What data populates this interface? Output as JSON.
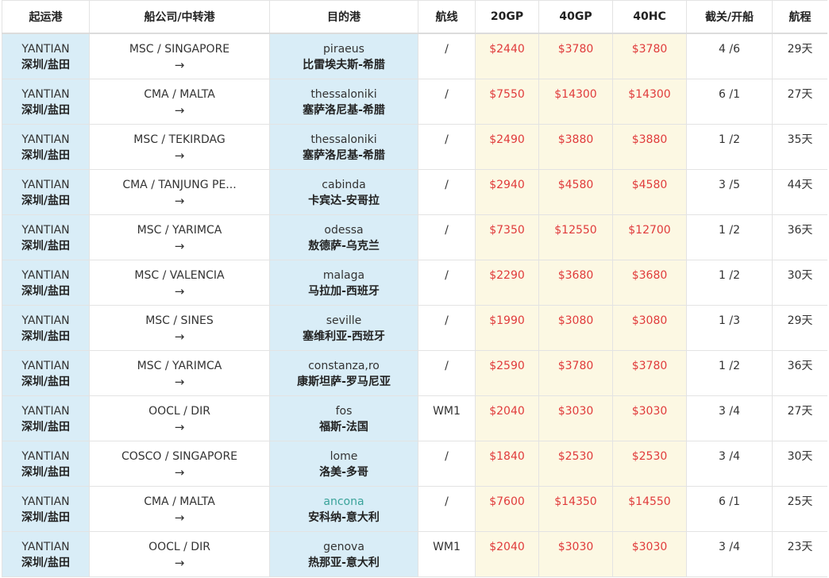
{
  "table": {
    "headers": [
      "起运港",
      "船公司/中转港",
      "目的港",
      "航线",
      "20GP",
      "40GP",
      "40HC",
      "截关/开船",
      "航程"
    ],
    "rows": [
      {
        "origin_en": "YANTIAN",
        "origin_cn": "深圳/盐田",
        "carrier": "MSC / SINGAPORE",
        "arrow": "→",
        "dest_en": "piraeus",
        "dest_cn": "比雷埃夫斯-希腊",
        "route": "/",
        "gp20": "$2440",
        "gp40": "$3780",
        "hc40": "$3780",
        "cutoff": "4 /6",
        "transit": "29天"
      },
      {
        "origin_en": "YANTIAN",
        "origin_cn": "深圳/盐田",
        "carrier": "CMA / MALTA",
        "arrow": "→",
        "dest_en": "thessaloniki",
        "dest_cn": "塞萨洛尼基-希腊",
        "route": "/",
        "gp20": "$7550",
        "gp40": "$14300",
        "hc40": "$14300",
        "cutoff": "6 /1",
        "transit": "27天"
      },
      {
        "origin_en": "YANTIAN",
        "origin_cn": "深圳/盐田",
        "carrier": "MSC / TEKIRDAG",
        "arrow": "→",
        "dest_en": "thessaloniki",
        "dest_cn": "塞萨洛尼基-希腊",
        "route": "/",
        "gp20": "$2490",
        "gp40": "$3880",
        "hc40": "$3880",
        "cutoff": "1 /2",
        "transit": "35天"
      },
      {
        "origin_en": "YANTIAN",
        "origin_cn": "深圳/盐田",
        "carrier": "CMA / TANJUNG PE...",
        "arrow": "→",
        "dest_en": "cabinda",
        "dest_cn": "卡宾达-安哥拉",
        "route": "/",
        "gp20": "$2940",
        "gp40": "$4580",
        "hc40": "$4580",
        "cutoff": "3 /5",
        "transit": "44天"
      },
      {
        "origin_en": "YANTIAN",
        "origin_cn": "深圳/盐田",
        "carrier": "MSC / YARIMCA",
        "arrow": "→",
        "dest_en": "odessa",
        "dest_cn": "敖德萨-乌克兰",
        "route": "/",
        "gp20": "$7350",
        "gp40": "$12550",
        "hc40": "$12700",
        "cutoff": "1 /2",
        "transit": "36天"
      },
      {
        "origin_en": "YANTIAN",
        "origin_cn": "深圳/盐田",
        "carrier": "MSC / VALENCIA",
        "arrow": "→",
        "dest_en": "malaga",
        "dest_cn": "马拉加-西班牙",
        "route": "/",
        "gp20": "$2290",
        "gp40": "$3680",
        "hc40": "$3680",
        "cutoff": "1 /2",
        "transit": "30天"
      },
      {
        "origin_en": "YANTIAN",
        "origin_cn": "深圳/盐田",
        "carrier": "MSC / SINES",
        "arrow": "→",
        "dest_en": "seville",
        "dest_cn": "塞维利亚-西班牙",
        "route": "/",
        "gp20": "$1990",
        "gp40": "$3080",
        "hc40": "$3080",
        "cutoff": "1 /3",
        "transit": "29天"
      },
      {
        "origin_en": "YANTIAN",
        "origin_cn": "深圳/盐田",
        "carrier": "MSC / YARIMCA",
        "arrow": "→",
        "dest_en": "constanza,ro",
        "dest_cn": "康斯坦萨-罗马尼亚",
        "route": "/",
        "gp20": "$2590",
        "gp40": "$3780",
        "hc40": "$3780",
        "cutoff": "1 /2",
        "transit": "36天"
      },
      {
        "origin_en": "YANTIAN",
        "origin_cn": "深圳/盐田",
        "carrier": "OOCL / DIR",
        "arrow": "→",
        "dest_en": "fos",
        "dest_cn": "福斯-法国",
        "route": "WM1",
        "gp20": "$2040",
        "gp40": "$3030",
        "hc40": "$3030",
        "cutoff": "3 /4",
        "transit": "27天"
      },
      {
        "origin_en": "YANTIAN",
        "origin_cn": "深圳/盐田",
        "carrier": "COSCO / SINGAPORE",
        "arrow": "→",
        "dest_en": "lome",
        "dest_cn": "洛美-多哥",
        "route": "/",
        "gp20": "$1840",
        "gp40": "$2530",
        "hc40": "$2530",
        "cutoff": "3 /4",
        "transit": "30天"
      },
      {
        "origin_en": "YANTIAN",
        "origin_cn": "深圳/盐田",
        "carrier": "CMA / MALTA",
        "arrow": "→",
        "dest_en": "ancona",
        "dest_cn": "安科纳-意大利",
        "route": "/",
        "gp20": "$7600",
        "gp40": "$14350",
        "hc40": "$14550",
        "cutoff": "6 /1",
        "transit": "25天",
        "dest_link": true
      },
      {
        "origin_en": "YANTIAN",
        "origin_cn": "深圳/盐田",
        "carrier": "OOCL / DIR",
        "arrow": "→",
        "dest_en": "genova",
        "dest_cn": "热那亚-意大利",
        "route": "WM1",
        "gp20": "$2040",
        "gp40": "$3030",
        "hc40": "$3030",
        "cutoff": "3 /4",
        "transit": "23天"
      }
    ]
  },
  "colors": {
    "origin_dest_bg": "#d9edf7",
    "price_bg": "#fcf8e3",
    "price_text": "#e03b3b",
    "hover_link": "#3aa39a"
  }
}
